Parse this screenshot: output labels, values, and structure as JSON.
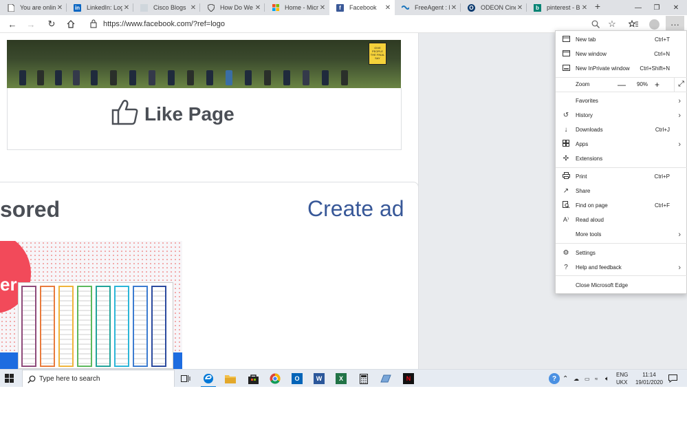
{
  "browser": {
    "tabs": [
      {
        "label": "You are online",
        "icon": "document-icon",
        "active": false
      },
      {
        "label": "LinkedIn: Log in",
        "icon": "linkedin-icon",
        "active": false
      },
      {
        "label": "Cisco Blogs",
        "icon": "cisco-icon",
        "active": false
      },
      {
        "label": "How Do We Ed",
        "icon": "shield-icon",
        "active": false
      },
      {
        "label": "Home - Micros",
        "icon": "microsoft-icon",
        "active": false
      },
      {
        "label": "Facebook",
        "icon": "facebook-icon",
        "active": true
      },
      {
        "label": "FreeAgent : Lo",
        "icon": "freeagent-icon",
        "active": false
      },
      {
        "label": "ODEON Cinem",
        "icon": "odeon-icon",
        "active": false
      },
      {
        "label": "pinterest - Bin",
        "icon": "bing-icon",
        "active": false
      }
    ],
    "url": "https://www.facebook.com/?ref=logo"
  },
  "page": {
    "like_label": "Like Page",
    "sponsored_label": "sored",
    "create_ad_label": "Create ad",
    "ad_letter": "er",
    "sign_text": "GIVE PEOPLE THE FINAL SAY"
  },
  "menu": {
    "items": [
      {
        "label": "New tab",
        "shortcut": "Ctrl+T",
        "icon": "new-tab-icon"
      },
      {
        "label": "New window",
        "shortcut": "Ctrl+N",
        "icon": "new-window-icon"
      },
      {
        "label": "New InPrivate window",
        "shortcut": "Ctrl+Shift+N",
        "icon": "inprivate-icon"
      },
      {
        "label": "Zoom",
        "zoom_value": "90%"
      },
      {
        "label": "Favorites",
        "icon": "favorites-icon"
      },
      {
        "label": "History",
        "icon": "history-icon"
      },
      {
        "label": "Downloads",
        "shortcut": "Ctrl+J",
        "icon": "download-icon"
      },
      {
        "label": "Apps",
        "icon": "apps-icon"
      },
      {
        "label": "Extensions",
        "icon": "extensions-icon"
      },
      {
        "label": "Print",
        "shortcut": "Ctrl+P",
        "icon": "print-icon"
      },
      {
        "label": "Share",
        "icon": "share-icon"
      },
      {
        "label": "Find on page",
        "shortcut": "Ctrl+F",
        "icon": "find-icon"
      },
      {
        "label": "Read aloud",
        "icon": "read-aloud-icon"
      },
      {
        "label": "More tools"
      },
      {
        "label": "Settings",
        "icon": "settings-icon"
      },
      {
        "label": "Help and feedback",
        "icon": "help-icon"
      },
      {
        "label": "Close Microsoft Edge"
      }
    ]
  },
  "taskbar": {
    "search_placeholder": "Type here to search",
    "lang_line1": "ENG",
    "lang_line2": "UKX",
    "time": "11:14",
    "date": "19/01/2020"
  },
  "colors": {
    "facebook_blue": "#385898",
    "page_bg": "#e9ebee",
    "edge_blue": "#0078d7"
  }
}
